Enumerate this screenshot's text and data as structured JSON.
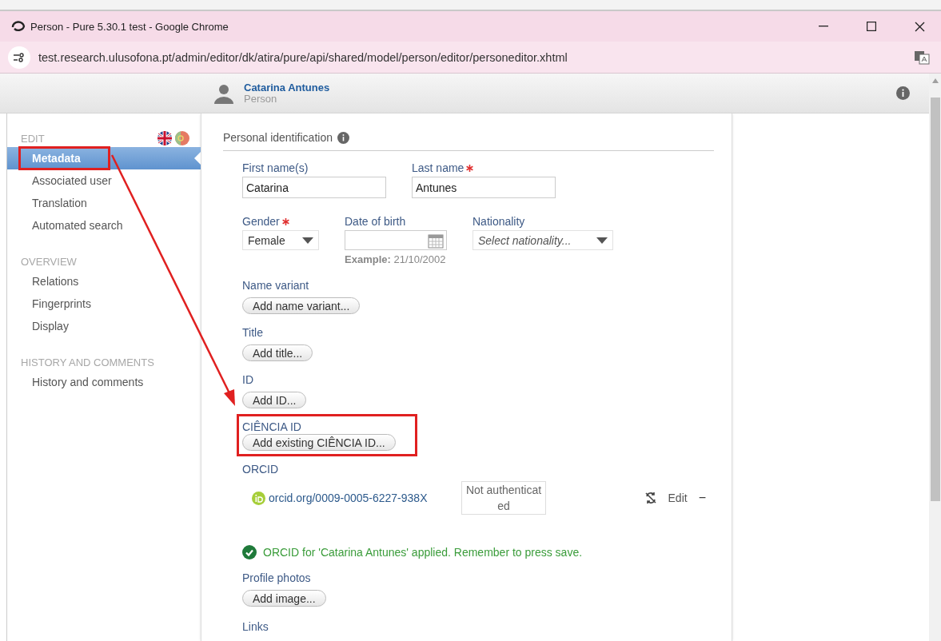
{
  "window": {
    "title": "Person - Pure 5.30.1 test - Google Chrome",
    "url": "test.research.ulusofona.pt/admin/editor/dk/atira/pure/api/shared/model/person/editor/personeditor.xhtml"
  },
  "header": {
    "name": "Catarina Antunes",
    "type": "Person"
  },
  "sidebar": {
    "sections": [
      {
        "title": "EDIT",
        "flags": true,
        "items": [
          {
            "label": "Metadata",
            "selected": true,
            "highlighted": true
          },
          {
            "label": "Associated user",
            "selected": false,
            "highlighted": false
          },
          {
            "label": "Translation",
            "selected": false,
            "highlighted": false
          },
          {
            "label": "Automated search",
            "selected": false,
            "highlighted": false
          }
        ]
      },
      {
        "title": "OVERVIEW",
        "flags": false,
        "items": [
          {
            "label": "Relations",
            "selected": false,
            "highlighted": false
          },
          {
            "label": "Fingerprints",
            "selected": false,
            "highlighted": false
          },
          {
            "label": "Display",
            "selected": false,
            "highlighted": false
          }
        ]
      },
      {
        "title": "HISTORY AND COMMENTS",
        "flags": false,
        "items": [
          {
            "label": "History and comments",
            "selected": false,
            "highlighted": false
          }
        ]
      }
    ]
  },
  "form": {
    "title": "Personal identification",
    "name_fields": [
      {
        "label": "First name(s)",
        "required": false,
        "value": "Catarina"
      },
      {
        "label": "Last name",
        "required": true,
        "value": "Antunes"
      }
    ],
    "detail_fields": [
      {
        "kind": "select",
        "label": "Gender",
        "required": true,
        "value": "Female"
      },
      {
        "kind": "date",
        "label": "Date of birth",
        "required": false,
        "hint_label": "Example:",
        "hint": "21/10/2002"
      },
      {
        "kind": "select",
        "label": "Nationality",
        "required": false,
        "placeholder": "Select nationality..."
      }
    ],
    "sections": [
      {
        "kind": "add",
        "label": "Name variant",
        "button": "Add name variant...",
        "highlighted": false
      },
      {
        "kind": "add",
        "label": "Title",
        "button": "Add title...",
        "highlighted": false
      },
      {
        "kind": "add",
        "label": "ID",
        "button": "Add ID...",
        "highlighted": false
      },
      {
        "kind": "add",
        "label": "CIÊNCIA ID",
        "button": "Add existing CIÊNCIA ID...",
        "highlighted": true
      },
      {
        "kind": "orcid",
        "label": "ORCID",
        "link": "orcid.org/0009-0005-6227-938X",
        "status": "Not authenticated",
        "edit": "Edit",
        "remove": "−",
        "message": "ORCID for 'Catarina Antunes' applied. Remember to press save."
      },
      {
        "kind": "add",
        "label": "Profile photos",
        "button": "Add image...",
        "highlighted": false
      },
      {
        "kind": "heading",
        "label": "Links"
      }
    ]
  },
  "annotation": {
    "arrow": true
  }
}
